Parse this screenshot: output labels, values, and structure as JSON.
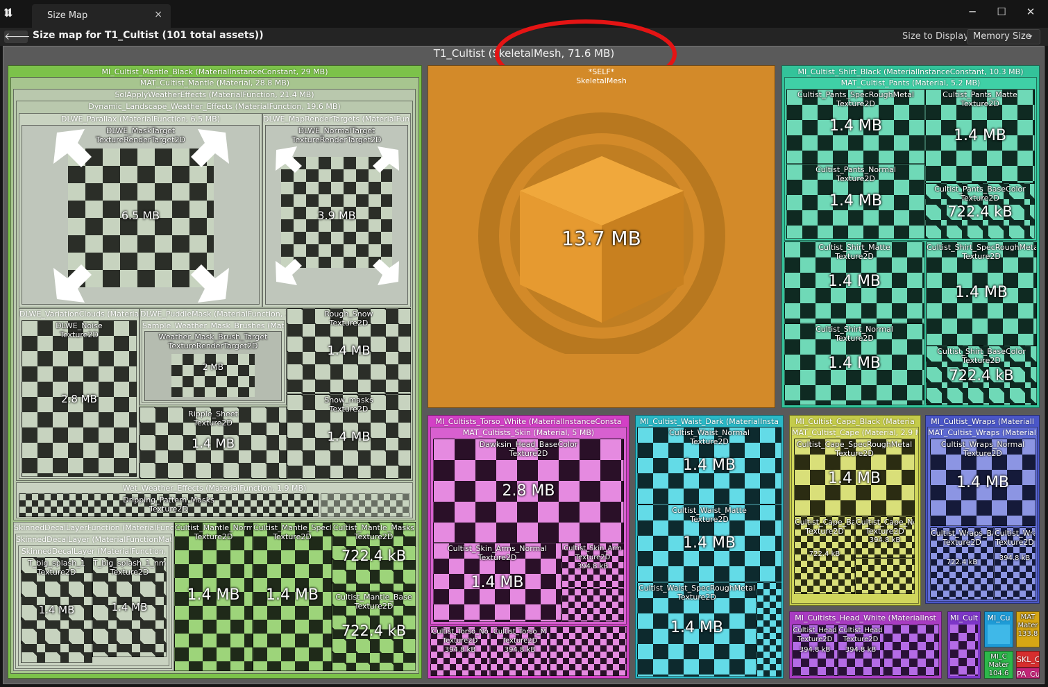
{
  "window": {
    "tab_title": "Size Map",
    "tab_close": "×",
    "heading": "Size map for T1_Cultist  (101 total assets))",
    "back": "🡐",
    "minimize": "─",
    "maximize": "☐",
    "close": "✕"
  },
  "toolbar": {
    "size_label": "Size to Display:",
    "size_value": "Memory Size",
    "size_chevron": "⌄"
  },
  "root": {
    "title": "T1_Cultist  (SkeletalMesh, 71.6 MB)"
  },
  "self": {
    "name": "*SELF*",
    "type": "SkeletalMesh",
    "size": "13.7 MB"
  },
  "mantle": {
    "title": "MI_Cultist_Mantle_Black  (MaterialInstanceConstant, 29 MB)",
    "mat": "MAT_Cultist_Mantle  (Material, 28.8 MB)",
    "solapply": "SolApplyWeatherEffects  (MaterialFunction, 21.4 MB)",
    "dynamic": "Dynamic_Landscape_Weather_Effects  (MaterialFunction, 19.6 MB)",
    "parallax": "DLWE_Parallax  (MaterialFunction, 6.5 MB)",
    "masktarget": "DLWE_MaskTarget",
    "masktarget_type": "TextureRenderTarget2D",
    "masktarget_size": "6.5 MB",
    "maprender": "DLWE_MapRenderTargets  (MaterialFunct",
    "normaltarget": "DLWE_NormalTarget",
    "normaltarget_type": "TextureRenderTarget2D",
    "normaltarget_size": "3.9 MB",
    "variation": "DLWE_VariationClouds  (Materiall",
    "noise": "DLWE_Noise",
    "noise_type": "Texture2D",
    "noise_size": "2.8 MB",
    "puddle": "DLWE_PuddleMask  (MaterialFunction, 2 M",
    "sample": "Sample_Weather_Mask_Brushes  (Mate",
    "brush": "Weather_Mask_Brush_Target",
    "brush_type": "TextureRenderTarget2D",
    "brush_size": "2 MB",
    "ripple": "Ripple_Sheet",
    "ripple_type": "Texture2D",
    "ripple_size": "1.4 MB",
    "rough": "Rough_Snow",
    "rough_type": "Texture2D",
    "rough_size": "1.4 MB",
    "snow": "Snow_masks",
    "snow_type": "Texture2D",
    "snow_size": "1.4 MB",
    "wet": "Wet_Weather_Effects  (MaterialFunction, 1.9 MB)",
    "drip": "Dripping_Pattern_Masks",
    "drip_type": "Texture2D",
    "skinnedfn": "SkinnedDecalLayerFunction  (MaterialFunctio",
    "skinnedlayer": "SkinnedDecalLayer  (MaterialFunctionMater",
    "skinnedlayer2": "SkinnedDecalLayer  (MaterialFunction,",
    "splash1": "T_big_splash_1",
    "splash1_type": "Texture2D",
    "splash1_size": "1.4 MB",
    "splash2": "T_big_splash_1_nm",
    "splash2_type": "Texture2D",
    "splash2_size": "1.4 MB",
    "mnormal": "Cultist_Mantle_Norma",
    "mnormal_type": "Texture2D",
    "mnormal_size": "1.4 MB",
    "mspec": "Cultist_Mantle_SpecR",
    "mspec_type": "Texture2D",
    "mspec_size": "1.4 MB",
    "mmasks": "Cultist_Mantle_Masks",
    "mmasks_type": "Texture2D",
    "mmasks_size": "722.4 kB",
    "mbase": "Cultist_Mantle_Base",
    "mbase_type": "Texture2D",
    "mbase_size": "722.4 kB"
  },
  "shirt": {
    "title": "MI_Cultist_Shirt_Black  (MaterialInstanceConstant, 10.3 MB)",
    "pants": "MAT_Cultist_Pants  (Material, 5.2 MB)",
    "p_spec": "Cultist_Pants_SpecRoughMetal",
    "p_spec_type": "Texture2D",
    "p_spec_size": "1.4 MB",
    "p_matte": "Cultist_Pants_Matte",
    "p_matte_type": "Texture2D",
    "p_matte_size": "1.4 MB",
    "p_normal": "Cultist_Pants_Normal",
    "p_normal_type": "Texture2D",
    "p_normal_size": "1.4 MB",
    "p_base": "Cultist_Pants_BaseColor",
    "p_base_type": "Texture2D",
    "p_base_size": "722.4 kB",
    "s_matte": "Cultist_Shirt_Matte",
    "s_matte_type": "Texture2D",
    "s_matte_size": "1.4 MB",
    "s_spec": "Cultist_Shirt_SpecRoughMetal",
    "s_spec_type": "Texture2D",
    "s_spec_size": "1.4 MB",
    "s_normal": "Cultist_Shirt_Normal",
    "s_normal_type": "Texture2D",
    "s_normal_size": "1.4 MB",
    "s_base": "Cultist_Shirt_BaseColor",
    "s_base_type": "Texture2D",
    "s_base_size": "722.4 kB"
  },
  "torso": {
    "title": "MI_Cultists_Torso_White  (MaterialInstanceConsta",
    "skin": "MAT_Cultists_Skin  (Material, 5 MB)",
    "dawk": "Dawksin_Head_BaseColor",
    "dawk_type": "Texture2D",
    "dawk_size": "2.8 MB",
    "arms": "Cultist_Skin_Arms_Normal",
    "arms_type": "Texture2D",
    "arms_size": "1.4 MB",
    "sarm": "Cultist_Skin_Arm",
    "sarm_type": "Texture2D",
    "sarm_size": "394.8 kB",
    "tn": "Cultist_Torso_No",
    "tn_type": "Texture2D",
    "tn_size": "394.8 kB",
    "tm": "Cultist_Torso_M",
    "tm_type": "Texture2D",
    "tm_size": "394.8 kB"
  },
  "waist": {
    "title": "MI_Cultist_Waist_Dark  (MaterialInsta",
    "n": "Cultist_Waist_Normal",
    "n_type": "Texture2D",
    "n_size": "1.4 MB",
    "m": "Cultist_Waist_Matte",
    "m_type": "Texture2D",
    "m_size": "1.4 MB",
    "s": "Cultist_Waist_SpecRoughMetal",
    "s_type": "Texture2D",
    "s_size": "1.4 MB"
  },
  "cape": {
    "title": "MI_Cultist_Cape_Black  (Materia",
    "mat": "MAT_Cultist_Cape  (Material, 2.9 M",
    "spec": "Cultist_Cape_SpecRoughMetal",
    "spec_type": "Texture2D",
    "spec_size": "1.4 MB",
    "ba": "Cultist_Cape_Ba",
    "ba_type": "Texture2D",
    "ba_size": "722.4 kB",
    "no": "Cultist_Cape_No",
    "no_type": "Texture2D",
    "no_size": "394.8 kB"
  },
  "wraps": {
    "title": "MI_Cultist_Wraps  (Materiall",
    "mat": "MAT_Cultist_Wraps  (Material,",
    "normal": "Cultist_Wraps_Normal",
    "normal_type": "Texture2D",
    "normal_size": "1.4 MB",
    "ba": "Cultist_Wraps_Ba",
    "ba_type": "Texture2D",
    "ba_size": "722.4 kB",
    "wr": "Cultist_Wra",
    "wr_type": "Texture2D",
    "wr_size": "394.8 kB"
  },
  "head": {
    "title": "MI_Cultists_Head_White  (MaterialInst",
    "h1": "Cultist_Head",
    "h1_type": "Texture2D",
    "h1_size": "394.8 kB",
    "h2": "Cultist_Head",
    "h2_type": "Texture2D",
    "h2_size": "394.8 kB"
  },
  "misc": {
    "cu": "MI_Cult",
    "ecu": "MI_Cu",
    "mat": "MAT",
    "mat2": "Mater",
    "mat3": "133.8",
    "mic": "MI_C",
    "mic2": "Mater",
    "mic3": "104.6",
    "skl": "SKL_C",
    "pa": "PA_Cu"
  }
}
